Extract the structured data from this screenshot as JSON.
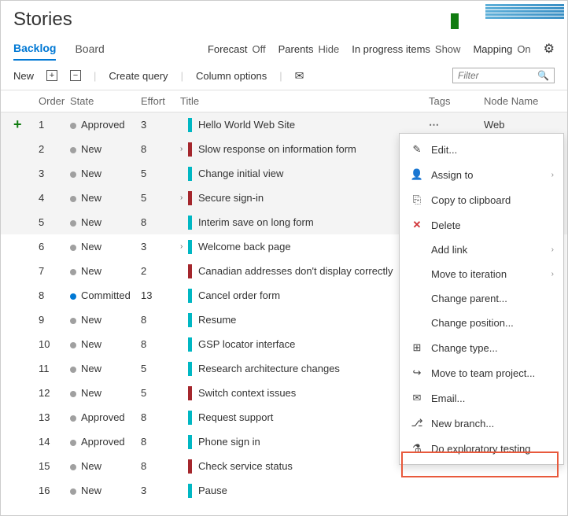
{
  "header": {
    "title": "Stories"
  },
  "tabs": {
    "backlog": "Backlog",
    "board": "Board"
  },
  "options": {
    "forecast_label": "Forecast",
    "forecast_val": "Off",
    "parents_label": "Parents",
    "parents_val": "Hide",
    "progress_label": "In progress items",
    "progress_val": "Show",
    "mapping_label": "Mapping",
    "mapping_val": "On"
  },
  "toolbar": {
    "new": "New",
    "create_query": "Create query",
    "column_options": "Column options",
    "filter_placeholder": "Filter"
  },
  "columns": {
    "order": "Order",
    "state": "State",
    "effort": "Effort",
    "title": "Title",
    "tags": "Tags",
    "node": "Node Name"
  },
  "node_value": "Web",
  "rows": [
    {
      "order": "1",
      "state": "Approved",
      "dot": "gray",
      "effort": "3",
      "bar": "teal",
      "chev": "",
      "title": "Hello World Web Site",
      "shade": true,
      "plus": true
    },
    {
      "order": "2",
      "state": "New",
      "dot": "gray",
      "effort": "8",
      "bar": "red",
      "chev": "›",
      "title": "Slow response on information form",
      "shade": true
    },
    {
      "order": "3",
      "state": "New",
      "dot": "gray",
      "effort": "5",
      "bar": "teal",
      "chev": "",
      "title": "Change initial view",
      "shade": true
    },
    {
      "order": "4",
      "state": "New",
      "dot": "gray",
      "effort": "5",
      "bar": "red",
      "chev": "›",
      "title": "Secure sign-in",
      "shade": true
    },
    {
      "order": "5",
      "state": "New",
      "dot": "gray",
      "effort": "8",
      "bar": "teal",
      "chev": "",
      "title": "Interim save on long form",
      "shade": true
    },
    {
      "order": "6",
      "state": "New",
      "dot": "gray",
      "effort": "3",
      "bar": "teal",
      "chev": "›",
      "title": "Welcome back page"
    },
    {
      "order": "7",
      "state": "New",
      "dot": "gray",
      "effort": "2",
      "bar": "red",
      "chev": "",
      "title": "Canadian addresses don't display correctly"
    },
    {
      "order": "8",
      "state": "Committed",
      "dot": "blue",
      "effort": "13",
      "bar": "teal",
      "chev": "",
      "title": "Cancel order form"
    },
    {
      "order": "9",
      "state": "New",
      "dot": "gray",
      "effort": "8",
      "bar": "teal",
      "chev": "",
      "title": "Resume"
    },
    {
      "order": "10",
      "state": "New",
      "dot": "gray",
      "effort": "8",
      "bar": "teal",
      "chev": "",
      "title": "GSP locator interface"
    },
    {
      "order": "11",
      "state": "New",
      "dot": "gray",
      "effort": "5",
      "bar": "teal",
      "chev": "",
      "title": "Research architecture changes"
    },
    {
      "order": "12",
      "state": "New",
      "dot": "gray",
      "effort": "5",
      "bar": "red",
      "chev": "",
      "title": "Switch context issues"
    },
    {
      "order": "13",
      "state": "Approved",
      "dot": "gray",
      "effort": "8",
      "bar": "teal",
      "chev": "",
      "title": "Request support"
    },
    {
      "order": "14",
      "state": "Approved",
      "dot": "gray",
      "effort": "8",
      "bar": "teal",
      "chev": "",
      "title": "Phone sign in"
    },
    {
      "order": "15",
      "state": "New",
      "dot": "gray",
      "effort": "8",
      "bar": "red",
      "chev": "",
      "title": "Check service status"
    },
    {
      "order": "16",
      "state": "New",
      "dot": "gray",
      "effort": "3",
      "bar": "teal",
      "chev": "",
      "title": "Pause"
    }
  ],
  "menu": {
    "edit": "Edit...",
    "assign": "Assign to",
    "copy": "Copy to clipboard",
    "delete": "Delete",
    "addlink": "Add link",
    "moveiter": "Move to iteration",
    "changeparent": "Change parent...",
    "changepos": "Change position...",
    "changetype": "Change type...",
    "moveproj": "Move to team project...",
    "email": "Email...",
    "newbranch": "New branch...",
    "exploratory": "Do exploratory testing"
  }
}
